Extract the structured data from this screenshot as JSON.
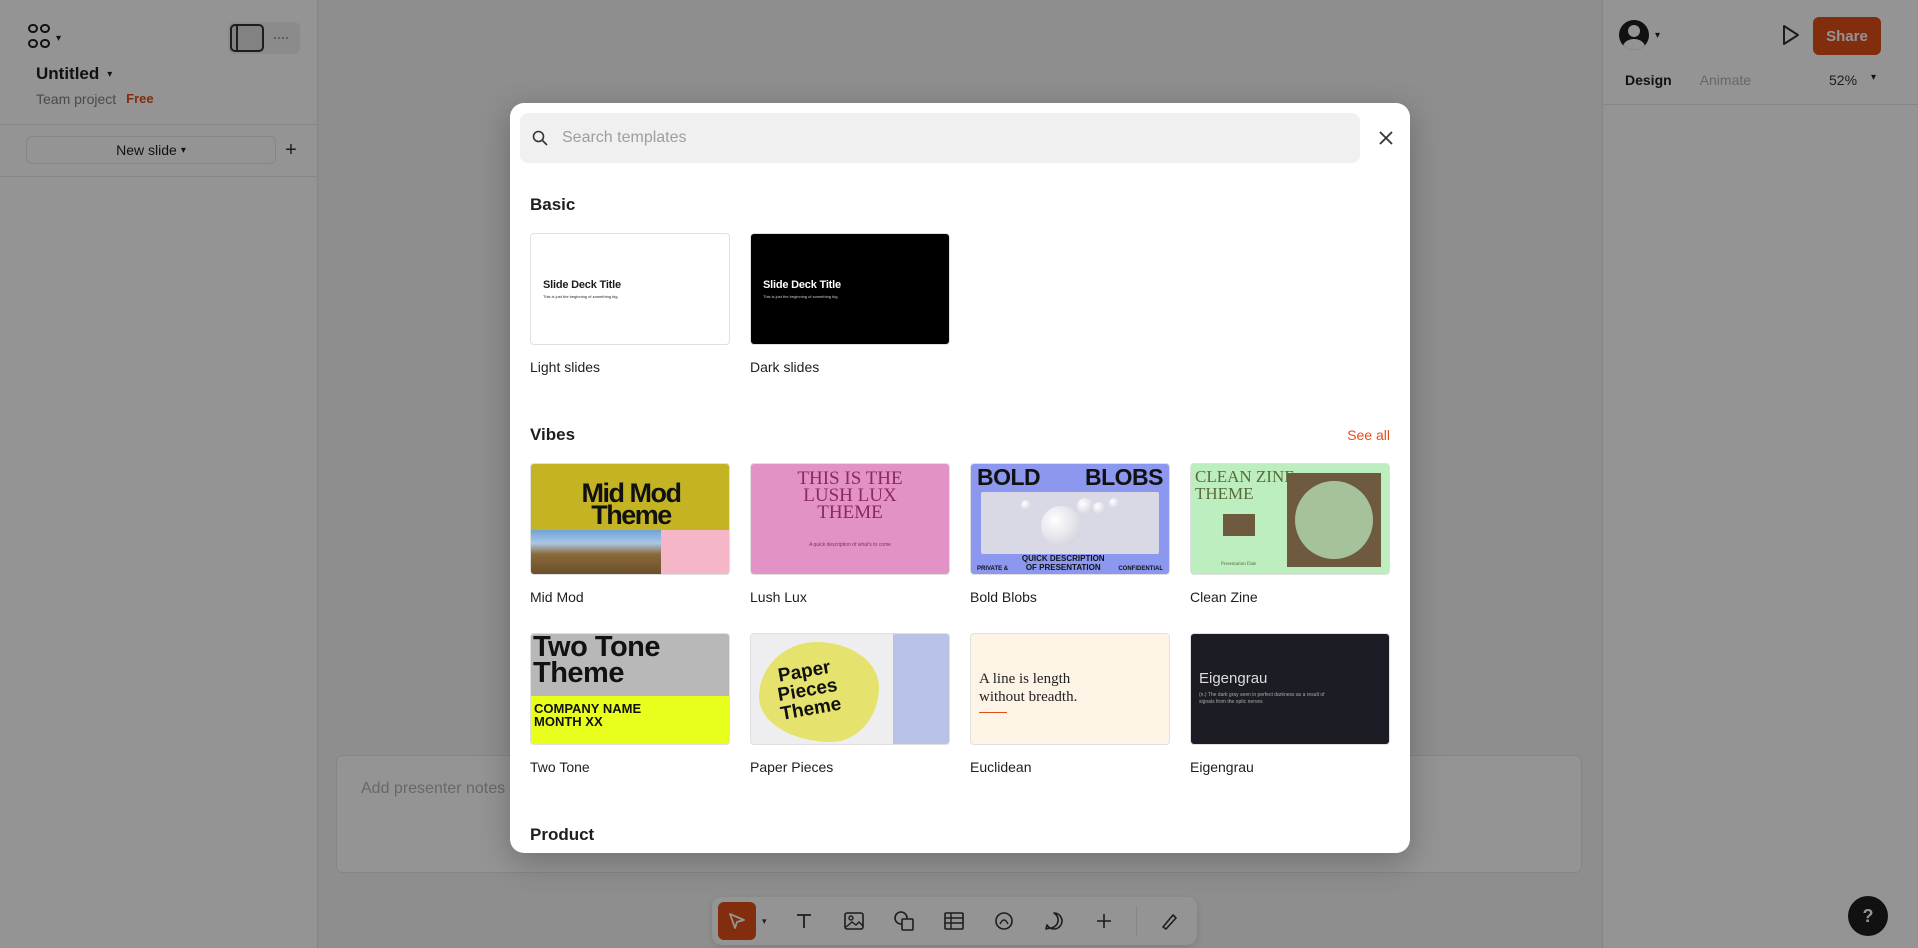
{
  "left_panel": {
    "file_title": "Untitled",
    "project": "Team project",
    "plan_badge": "Free",
    "new_slide_label": "New slide",
    "add_slide_icon": "plus-icon"
  },
  "right_panel": {
    "share_label": "Share",
    "tabs": [
      "Design",
      "Animate"
    ],
    "zoom": "52%"
  },
  "canvas": {
    "presenter_notes_placeholder": "Add presenter notes"
  },
  "toolbar": {
    "tools": [
      "move-icon",
      "text-icon",
      "image-icon",
      "shapes-icon",
      "table-icon",
      "stamp-icon",
      "comment-icon",
      "plus-icon",
      "draw-icon"
    ],
    "help_label": "?"
  },
  "modal": {
    "search_placeholder": "Search templates",
    "sections": {
      "basic": {
        "title": "Basic",
        "cards": [
          {
            "label": "Light slides",
            "thumb_title": "Slide Deck Title",
            "thumb_sub": "This is just the beginning of something big."
          },
          {
            "label": "Dark slides",
            "thumb_title": "Slide Deck Title",
            "thumb_sub": "This is just the beginning of something big."
          }
        ]
      },
      "vibes": {
        "title": "Vibes",
        "see_all": "See all",
        "cards": [
          {
            "label": "Mid Mod",
            "thumb_line1": "Mid Mod",
            "thumb_line2": "Theme"
          },
          {
            "label": "Lush Lux",
            "thumb_line1": "THIS IS THE",
            "thumb_line2": "LUSH LUX",
            "thumb_line3": "THEME",
            "thumb_sub": "A quick description of what's to come"
          },
          {
            "label": "Bold Blobs",
            "thumb_left": "BOLD",
            "thumb_right": "BLOBS",
            "foot_left": "PRIVATE &",
            "foot_mid_1": "QUICK DESCRIPTION",
            "foot_mid_2": "OF PRESENTATION",
            "foot_right": "CONFIDENTIAL"
          },
          {
            "label": "Clean Zine",
            "thumb_line1": "CLEAN ZINE",
            "thumb_line2": "THEME",
            "thumb_sub": "Presentation Date"
          },
          {
            "label": "Two Tone",
            "thumb_line1": "Two Tone",
            "thumb_line2": "Theme",
            "band_line1": "COMPANY NAME",
            "band_line2": "MONTH XX"
          },
          {
            "label": "Paper Pieces",
            "thumb_line1": "Paper",
            "thumb_line2": "Pieces",
            "thumb_line3": "Theme"
          },
          {
            "label": "Euclidean",
            "thumb_line1": "A line is length",
            "thumb_line2": "without breadth."
          },
          {
            "label": "Eigengrau",
            "thumb_title": "Eigengrau",
            "thumb_sub": "(n.) The dark gray seen in perfect darkness as a result of signals from the optic nerves"
          }
        ]
      },
      "product": {
        "title": "Product"
      }
    }
  },
  "colors": {
    "accent": "#e24e1b",
    "overlay": "rgba(0,0,0,0.42)"
  }
}
